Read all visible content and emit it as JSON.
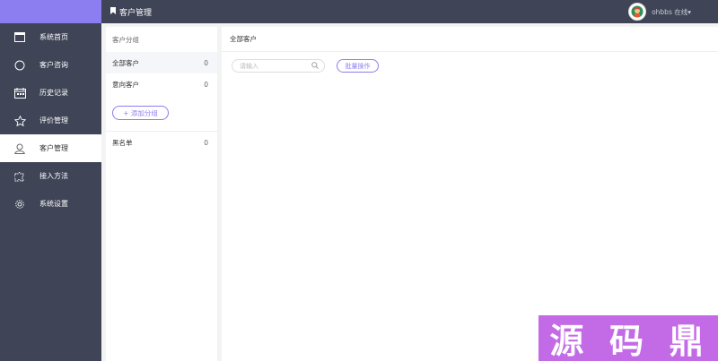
{
  "topbar": {
    "page_title": "客户管理",
    "username": "ohbbs 在线▾"
  },
  "sidebar": {
    "items": [
      {
        "label": "系统首页",
        "icon": "window-icon"
      },
      {
        "label": "客户咨询",
        "icon": "chat-circle-icon"
      },
      {
        "label": "历史记录",
        "icon": "calendar-icon"
      },
      {
        "label": "评价管理",
        "icon": "star-icon"
      },
      {
        "label": "客户管理",
        "icon": "user-icon",
        "active": true
      },
      {
        "label": "接入方法",
        "icon": "puzzle-icon"
      },
      {
        "label": "系统设置",
        "icon": "gear-icon"
      }
    ]
  },
  "groups": {
    "header": "客户分组",
    "items": [
      {
        "label": "全部客户",
        "count": "0"
      },
      {
        "label": "意向客户",
        "count": "0"
      }
    ],
    "add_label": "+ 添加分组",
    "blacklist": {
      "label": "黑名单",
      "count": "0"
    }
  },
  "main": {
    "header": "全部客户",
    "search_placeholder": "请输入",
    "batch_label": "批量操作"
  },
  "watermark": {
    "text": [
      "源",
      "码",
      "鼎"
    ]
  },
  "colors": {
    "accent": "#8c7ef0",
    "sidebar_bg": "#3f4456",
    "watermark_bg": "#c36be6"
  }
}
